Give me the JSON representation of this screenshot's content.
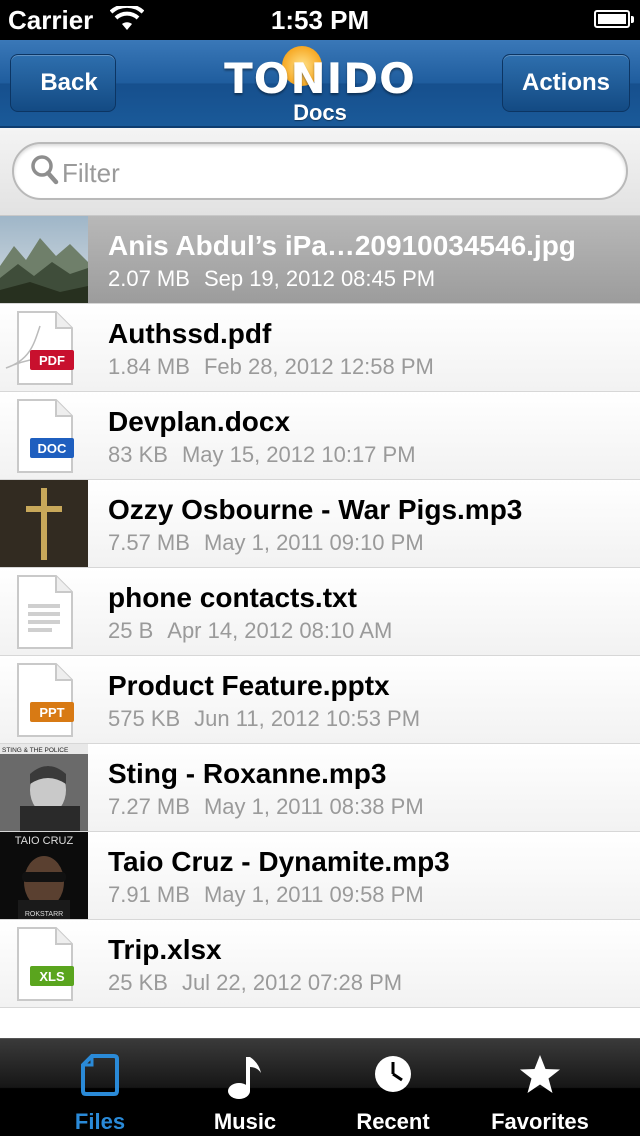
{
  "status": {
    "carrier": "Carrier",
    "time": "1:53 PM"
  },
  "nav": {
    "back_label": "Back",
    "logo_text": "TONIDO",
    "subtitle": "Docs",
    "actions_label": "Actions"
  },
  "search": {
    "placeholder": "Filter"
  },
  "files": [
    {
      "name": "Anis Abdul’s iPa…20910034546.jpg",
      "size": "2.07 MB",
      "date": "Sep 19, 2012 08:45 PM",
      "type": "image",
      "selected": true
    },
    {
      "name": "Authssd.pdf",
      "size": "1.84 MB",
      "date": "Feb 28, 2012 12:58 PM",
      "type": "pdf",
      "badge": "PDF",
      "badge_color": "#c8102e"
    },
    {
      "name": "Devplan.docx",
      "size": "83 KB",
      "date": "May 15, 2012 10:17 PM",
      "type": "doc",
      "badge": "DOC",
      "badge_color": "#1f5fbf"
    },
    {
      "name": "Ozzy Osbourne - War Pigs.mp3",
      "size": "7.57 MB",
      "date": "May 1, 2011 09:10 PM",
      "type": "album"
    },
    {
      "name": "phone contacts.txt",
      "size": "25 B",
      "date": "Apr 14, 2012 08:10 AM",
      "type": "txt"
    },
    {
      "name": "Product Feature.pptx",
      "size": "575 KB",
      "date": "Jun 11, 2012 10:53 PM",
      "type": "ppt",
      "badge": "PPT",
      "badge_color": "#d87a14"
    },
    {
      "name": "Sting - Roxanne.mp3",
      "size": "7.27 MB",
      "date": "May 1, 2011 08:38 PM",
      "type": "album"
    },
    {
      "name": "Taio Cruz - Dynamite.mp3",
      "size": "7.91 MB",
      "date": "May 1, 2011 09:58 PM",
      "type": "album"
    },
    {
      "name": "Trip.xlsx",
      "size": "25 KB",
      "date": "Jul 22, 2012 07:28 PM",
      "type": "xls",
      "badge": "XLS",
      "badge_color": "#5aa51e"
    }
  ],
  "album_art": {
    "sting": "STING & THE POLICE",
    "taio_top": "TAIO CRUZ",
    "taio_bottom": "ROKSTARR"
  },
  "tabs": [
    {
      "label": "Files",
      "icon": "file-icon",
      "active": true
    },
    {
      "label": "Music",
      "icon": "music-note-icon"
    },
    {
      "label": "Recent",
      "icon": "clock-icon"
    },
    {
      "label": "Favorites",
      "icon": "star-icon"
    }
  ],
  "colors": {
    "nav_blue": "#1f5d9e",
    "active_tab": "#2a8ad8"
  }
}
